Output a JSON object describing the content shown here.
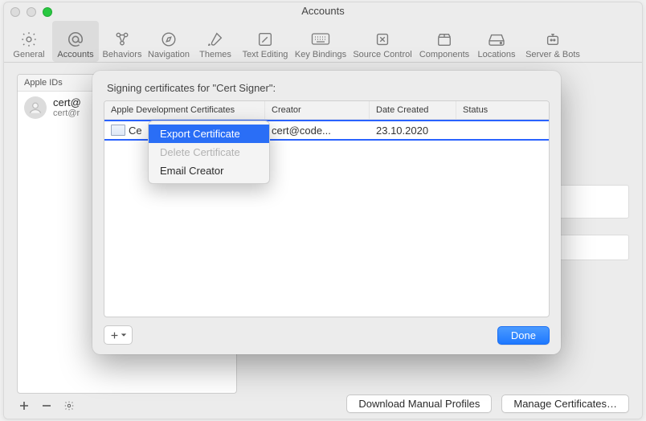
{
  "window": {
    "title": "Accounts"
  },
  "toolbar": {
    "items": [
      {
        "label": "General"
      },
      {
        "label": "Accounts"
      },
      {
        "label": "Behaviors"
      },
      {
        "label": "Navigation"
      },
      {
        "label": "Themes"
      },
      {
        "label": "Text Editing"
      },
      {
        "label": "Key Bindings"
      },
      {
        "label": "Source Control"
      },
      {
        "label": "Components"
      },
      {
        "label": "Locations"
      },
      {
        "label": "Server & Bots"
      }
    ]
  },
  "ids_panel": {
    "header": "Apple IDs",
    "account": {
      "line1": "cert@",
      "line2": "cert@r"
    }
  },
  "right_buttons": {
    "download": "Download Manual Profiles",
    "manage": "Manage Certificates…"
  },
  "popover": {
    "title": "Signing certificates for \"Cert Signer\":",
    "columns": {
      "name": "Apple Development Certificates",
      "creator": "Creator",
      "date": "Date Created",
      "status": "Status"
    },
    "row": {
      "name": "Ce",
      "creator": "cert@code...",
      "date": "23.10.2020",
      "status": ""
    },
    "done": "Done"
  },
  "context_menu": {
    "export": "Export Certificate",
    "delete": "Delete Certificate",
    "email": "Email Creator"
  }
}
